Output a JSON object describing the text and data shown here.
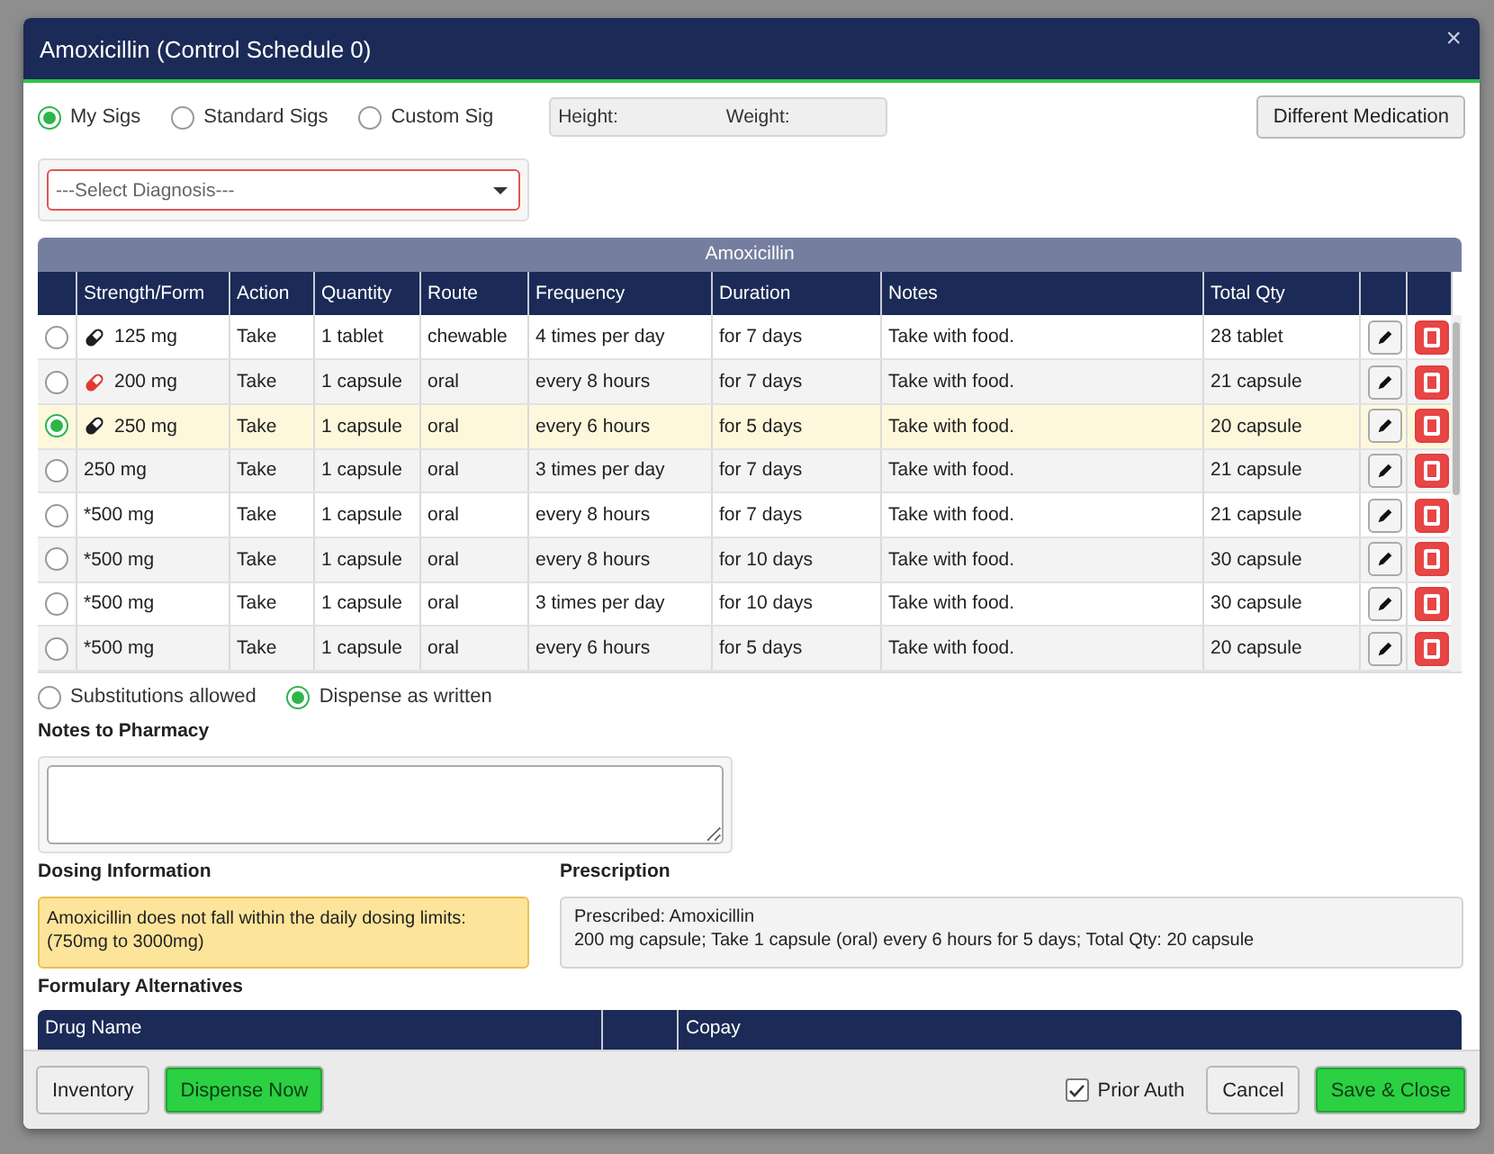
{
  "dialog": {
    "title": "Amoxicillin (Control Schedule 0)",
    "close": "×"
  },
  "sig_types": [
    {
      "label": "My Sigs",
      "selected": true
    },
    {
      "label": "Standard Sigs",
      "selected": false
    },
    {
      "label": "Custom Sig",
      "selected": false
    }
  ],
  "vitals": {
    "height_label": "Height:",
    "weight_label": "Weight:"
  },
  "different_medication": "Different Medication",
  "diagnosis": {
    "placeholder": "---Select Diagnosis---"
  },
  "sig_table": {
    "caption": "Amoxicillin",
    "columns": [
      "Strength/Form",
      "Action",
      "Quantity",
      "Route",
      "Frequency",
      "Duration",
      "Notes",
      "Total Qty"
    ],
    "rows": [
      {
        "strength": "125 mg",
        "color": "#1f1f1f",
        "action": "Take",
        "quantity": "1 tablet",
        "route": "chewable",
        "frequency": "4 times per day",
        "duration": "for 7 days",
        "notes": "Take with food.",
        "total_qty": "28 tablet",
        "selected": false
      },
      {
        "strength": "200 mg",
        "color": "#e53935",
        "action": "Take",
        "quantity": "1 capsule",
        "route": "oral",
        "frequency": "every 8 hours",
        "duration": "for 7 days",
        "notes": "Take with food.",
        "total_qty": "21 capsule",
        "selected": false
      },
      {
        "strength": "250 mg",
        "color": "#1f1f1f",
        "action": "Take",
        "quantity": "1 capsule",
        "route": "oral",
        "frequency": "every 6 hours",
        "duration": "for 5 days",
        "notes": "Take with food.",
        "total_qty": "20 capsule",
        "selected": true
      },
      {
        "strength": "250 mg",
        "action": "Take",
        "quantity": "1 capsule",
        "route": "oral",
        "frequency": "3 times per day",
        "duration": "for 7 days",
        "notes": "Take with food.",
        "total_qty": "21 capsule",
        "selected": false
      },
      {
        "strength": "*500 mg",
        "action": "Take",
        "quantity": "1 capsule",
        "route": "oral",
        "frequency": "every 8 hours",
        "duration": "for 7 days",
        "notes": "Take with food.",
        "total_qty": "21 capsule",
        "selected": false
      },
      {
        "strength": "*500 mg",
        "action": "Take",
        "quantity": "1 capsule",
        "route": "oral",
        "frequency": "every 8 hours",
        "duration": "for 10 days",
        "notes": "Take with food.",
        "total_qty": "30 capsule",
        "selected": false
      },
      {
        "strength": "*500 mg",
        "action": "Take",
        "quantity": "1 capsule",
        "route": "oral",
        "frequency": "3 times per day",
        "duration": "for 10 days",
        "notes": "Take with food.",
        "total_qty": "30 capsule",
        "selected": false
      },
      {
        "strength": "*500 mg",
        "action": "Take",
        "quantity": "1 capsule",
        "route": "oral",
        "frequency": "every 6 hours",
        "duration": "for 5 days",
        "notes": "Take with food.",
        "total_qty": "20 capsule",
        "selected": false
      }
    ]
  },
  "dispense_options": [
    {
      "label": "Substitutions allowed",
      "selected": false
    },
    {
      "label": "Dispense as written",
      "selected": true
    }
  ],
  "notes_to_pharmacy": {
    "label": "Notes to Pharmacy"
  },
  "dosing_information": {
    "label": "Dosing Information",
    "message": "Amoxicillin does not fall within the daily dosing limits: (750mg to 3000mg)"
  },
  "prescription": {
    "label": "Prescription",
    "line_1": "Prescribed: Amoxicillin",
    "line_2": "200 mg capsule; Take 1 capsule (oral) every 6 hours for 5 days; Total Qty: 20 capsule"
  },
  "formulary_alternatives": {
    "label": "Formulary Alternatives",
    "columns": [
      "Drug Name",
      "Copay"
    ]
  },
  "footer": {
    "inventory": "Inventory",
    "dispense_now": "Dispense Now",
    "prior_auth": {
      "label": "Prior Auth",
      "checked": true
    },
    "cancel": "Cancel",
    "save_close": "Save & Close"
  }
}
